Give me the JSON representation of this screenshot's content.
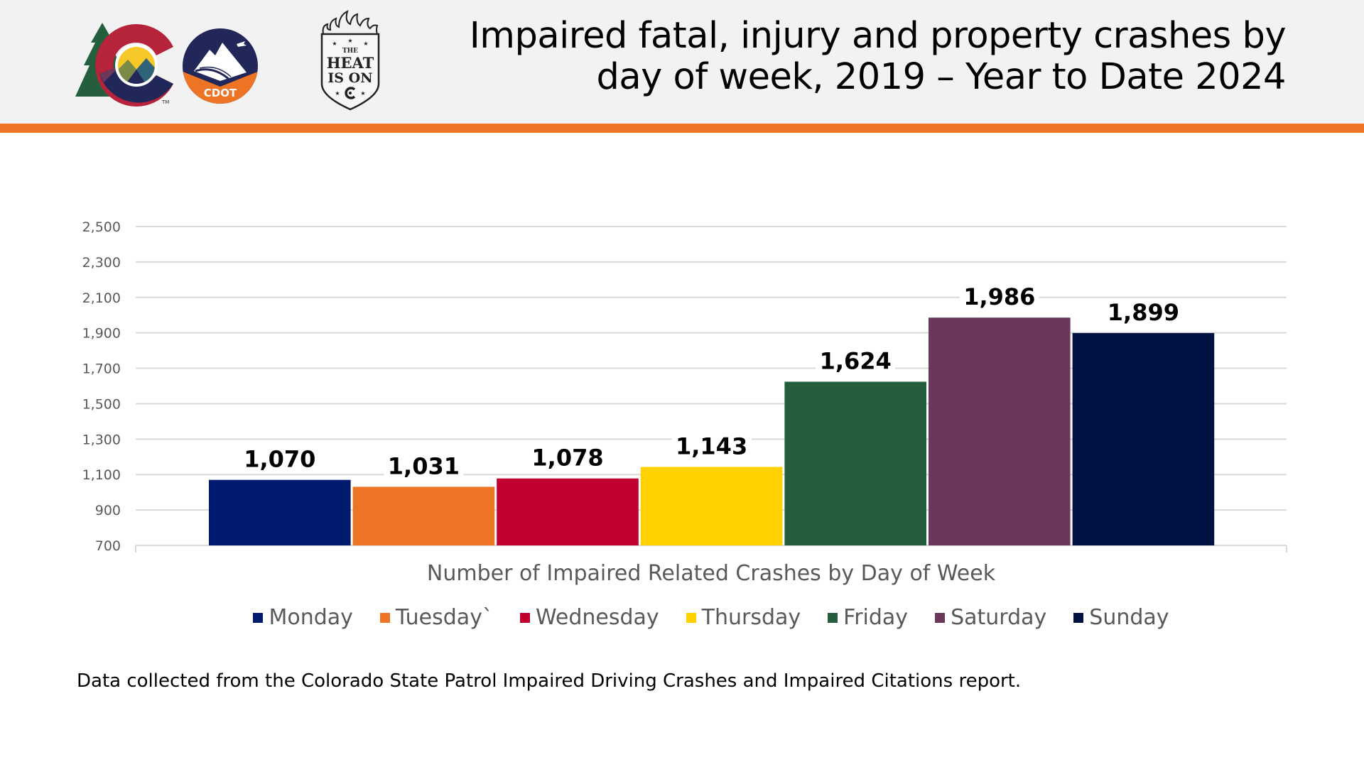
{
  "header": {
    "title_line1": "Impaired fatal, injury and property crashes by",
    "title_line2": "day of week, 2019 – Year to Date 2024",
    "logos": {
      "colorado": "colorado-state-logo",
      "cdot": "cdot-logo",
      "cdot_text": "CDOT",
      "heat": "the-heat-is-on-badge",
      "heat_text_top": "THE",
      "heat_text_mid": "HEAT",
      "heat_text_bottom": "IS ON",
      "trademark": "TM"
    },
    "colors": {
      "band": "#f2f2f2",
      "stripe": "#ec7424"
    }
  },
  "chart_data": {
    "type": "bar",
    "title": "",
    "xlabel": "Number of Impaired Related Crashes by Day of Week",
    "ylabel": "",
    "categories": [
      "Monday",
      "Tuesday`",
      "Wednesday",
      "Thursday",
      "Friday",
      "Saturday",
      "Sunday"
    ],
    "values": [
      1070,
      1031,
      1078,
      1143,
      1624,
      1986,
      1899
    ],
    "value_labels": [
      "1,070",
      "1,031",
      "1,078",
      "1,143",
      "1,624",
      "1,986",
      "1,899"
    ],
    "colors": [
      "#001a6e",
      "#ec7424",
      "#c20030",
      "#ffd100",
      "#245e3d",
      "#6b385c",
      "#001242"
    ],
    "ylim": [
      700,
      2500
    ],
    "yticks": [
      700,
      900,
      1100,
      1300,
      1500,
      1700,
      1900,
      2100,
      2300,
      2500
    ],
    "ytick_labels": [
      "700",
      "900",
      "1,100",
      "1,300",
      "1,500",
      "1,700",
      "1,900",
      "2,100",
      "2,300",
      "2,500"
    ],
    "grid": true,
    "legend": "bottom",
    "legend_entries": [
      "Monday",
      "Tuesday`",
      "Wednesday",
      "Thursday",
      "Friday",
      "Saturday",
      "Sunday"
    ]
  },
  "footnote": "Data collected from the Colorado State Patrol Impaired Driving Crashes and Impaired Citations report."
}
